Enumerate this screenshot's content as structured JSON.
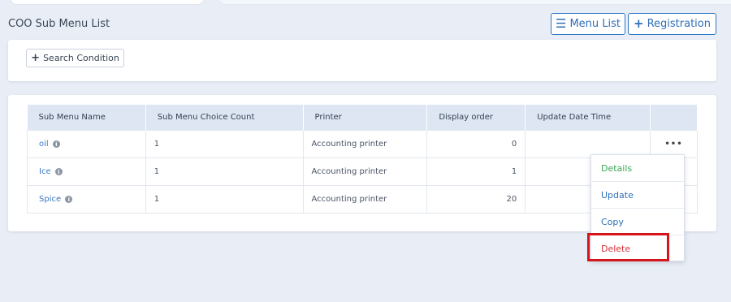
{
  "header": {
    "title": "COO Sub Menu List",
    "menu_list_label": "Menu List",
    "registration_label": "Registration"
  },
  "search": {
    "button_label": "Search Condition"
  },
  "table": {
    "columns": [
      "Sub Menu Name",
      "Sub Menu Choice Count",
      "Printer",
      "Display order",
      "Update Date Time"
    ],
    "rows": [
      {
        "name": "oil",
        "count": "1",
        "printer": "Accounting printer",
        "order": "0",
        "updated": ""
      },
      {
        "name": "Ice",
        "count": "1",
        "printer": "Accounting printer",
        "order": "1",
        "updated": ""
      },
      {
        "name": "Spice",
        "count": "1",
        "printer": "Accounting printer",
        "order": "20",
        "updated": ""
      }
    ],
    "row_menu_label": "•••"
  },
  "dropdown": {
    "details": "Details",
    "update": "Update",
    "copy": "Copy",
    "delete": "Delete"
  },
  "icons": {
    "menu_list": "list-icon",
    "registration": "plus-icon",
    "search": "plus-icon",
    "info": "info-icon"
  },
  "colors": {
    "accent": "#2f6fb8",
    "details": "#3aa655",
    "delete": "#d9303a",
    "highlight": "#d6141b"
  }
}
